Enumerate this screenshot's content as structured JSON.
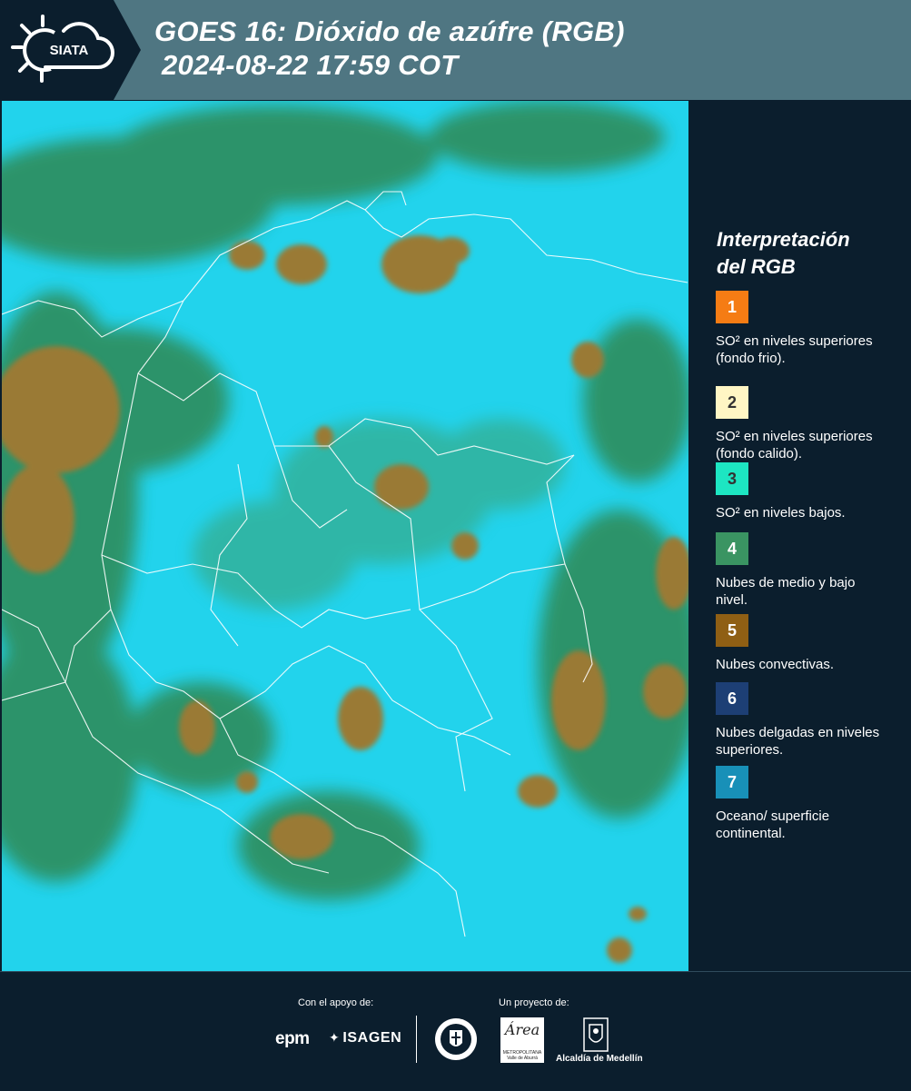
{
  "header": {
    "logo_text": "SIATA",
    "title_line1": "GOES 16: Dióxido de azúfre (RGB)",
    "title_line2": "2024-08-22 17:59 COT",
    "background_color": "#4f7682"
  },
  "map": {
    "icon": "satellite-map",
    "background_color": "#1fd6f0",
    "cloud_color": "#9a7a35",
    "vegetation_color": "#3a8a5a"
  },
  "legend": {
    "title_line1": "Interpretación",
    "title_line2": "del RGB",
    "items": [
      {
        "number": "1",
        "color": "#f57c14",
        "text_color": "#ffffff",
        "label": "SO² en niveles superiores (fondo frio)."
      },
      {
        "number": "2",
        "color": "#fff6c4",
        "text_color": "#333333",
        "label": "SO² en niveles superiores (fondo calido)."
      },
      {
        "number": "3",
        "color": "#1de6c2",
        "text_color": "#333333",
        "label": "SO² en niveles bajos."
      },
      {
        "number": "4",
        "color": "#3a9462",
        "text_color": "#ffffff",
        "label": "Nubes de medio y bajo nivel."
      },
      {
        "number": "5",
        "color": "#8f5f14",
        "text_color": "#ffffff",
        "label": "Nubes convectivas."
      },
      {
        "number": "6",
        "color": "#1d3f75",
        "text_color": "#ffffff",
        "label": "Nubes delgadas en niveles superiores."
      },
      {
        "number": "7",
        "color": "#1890b8",
        "text_color": "#ffffff",
        "label": "Oceano/ superficie continental."
      }
    ]
  },
  "footer": {
    "support_label": "Con el apoyo de:",
    "project_label": "Un proyecto de:",
    "epm_logo": "epm",
    "isagen_logo": "ISAGEN",
    "area_logo": "Área",
    "area_sub": "METROPOLITANA Valle de Aburrá",
    "alcaldia_label": "Alcaldía de Medellín"
  }
}
